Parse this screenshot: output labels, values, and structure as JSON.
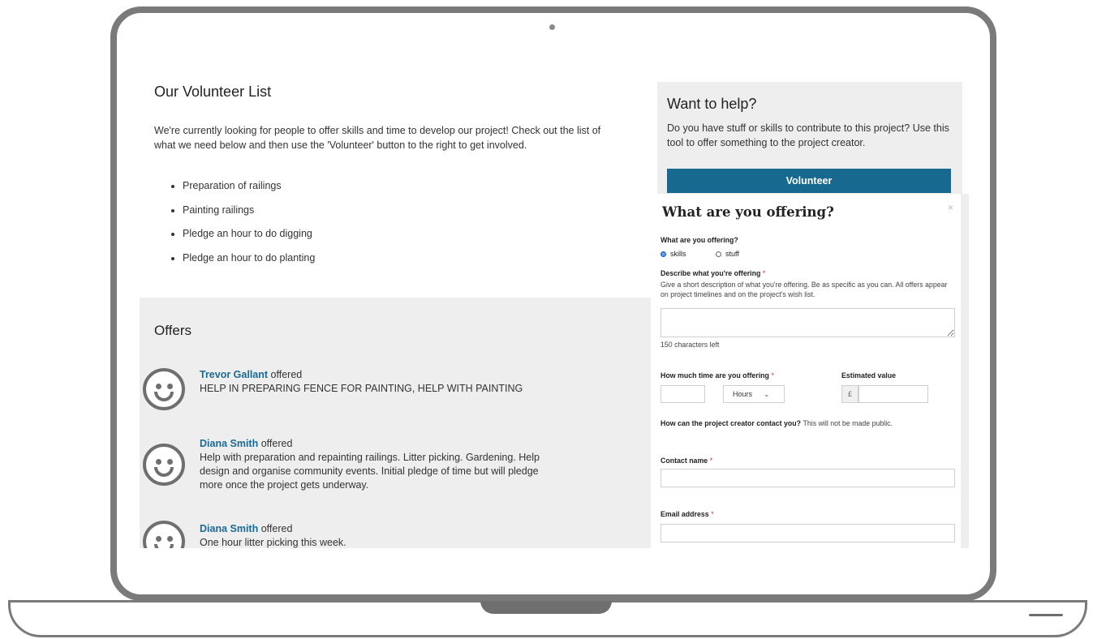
{
  "volunteer": {
    "title": "Our Volunteer List",
    "intro": "We're currently looking for people to offer skills and time to develop our project! Check out the list of what we need below and then use the 'Volunteer' button to the right to get involved.",
    "needs": [
      "Preparation of railings",
      "Painting railings",
      "Pledge an hour to do digging",
      "Pledge an hour to do planting"
    ]
  },
  "offers": {
    "title": "Offers",
    "items": [
      {
        "name": "Trevor Gallant",
        "verb": "offered",
        "text": "HELP IN PREPARING FENCE FOR PAINTING, HELP WITH PAINTING"
      },
      {
        "name": "Diana Smith",
        "verb": "offered",
        "text": "Help with preparation and repainting railings. Litter picking. Gardening. Help design and organise community events. Initial pledge of time but will pledge more once the project gets underway."
      },
      {
        "name": "Diana Smith",
        "verb": "offered",
        "text": "One hour litter picking this week."
      }
    ]
  },
  "help": {
    "title": "Want to help?",
    "text": "Do you have stuff or skills to contribute to this project? Use this tool to offer something to the project creator.",
    "button": "Volunteer"
  },
  "modal": {
    "title": "What are you offering?",
    "close": "×",
    "type_label": "What are you offering?",
    "options": [
      "skills",
      "stuff"
    ],
    "selected_option": "skills",
    "describe_label": "Describe what you're offering",
    "required_mark": "*",
    "describe_help": "Give a short description of what you're offering. Be as specific as you can. All offers appear on project timelines and on the project's wish list.",
    "chars_left": "150 characters left",
    "time_label": "How much time are you offering",
    "time_unit": "Hours",
    "value_label": "Estimated value",
    "currency": "£",
    "contact_prompt": "How can the project creator contact you?",
    "contact_note": "This will not be made public.",
    "contact_name_label": "Contact name",
    "email_label": "Email address"
  }
}
